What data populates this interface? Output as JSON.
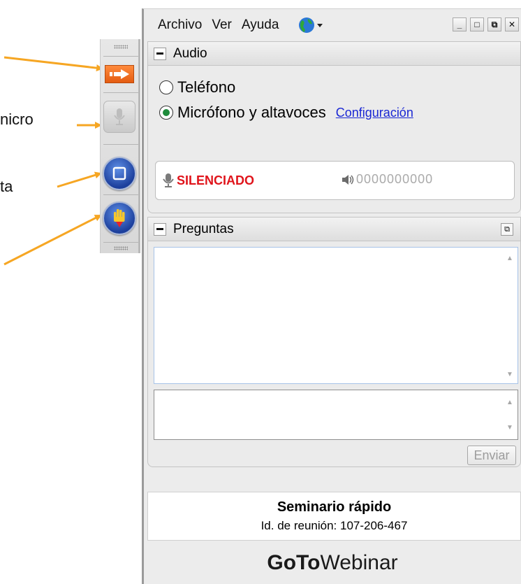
{
  "annotations": {
    "label_1": "nicro",
    "label_2": "ta"
  },
  "colors": {
    "arrow": "#f6a623",
    "accent_orange": "#e45c12",
    "muted_red": "#e0141b",
    "link_blue": "#1a27d4"
  },
  "toolbar": {
    "buttons": [
      {
        "name": "expand-panel-button",
        "icon": "arrow-right-icon"
      },
      {
        "name": "microphone-button",
        "icon": "microphone-icon"
      },
      {
        "name": "screen-button",
        "icon": "square-icon"
      },
      {
        "name": "raise-hand-button",
        "icon": "hand-icon"
      }
    ]
  },
  "menu": {
    "items": [
      "Archivo",
      "Ver",
      "Ayuda"
    ],
    "language_icon": "globe-icon"
  },
  "window_controls": {
    "minimize": "_",
    "maximize": "□",
    "restore": "⧉",
    "close": "✕"
  },
  "audio": {
    "title": "Audio",
    "option_phone": "Teléfono",
    "option_mic": "Micrófono y altavoces",
    "selected": "Micrófono y altavoces",
    "settings_link": "Configuración",
    "status": "SILENCIADO",
    "level_meter": "0000000000"
  },
  "questions": {
    "title": "Preguntas",
    "send_label": "Enviar"
  },
  "session": {
    "title": "Seminario rápido",
    "meeting_id": "Id. de reunión: 107-206-467"
  },
  "brand": {
    "bold": "GoTo",
    "light": "Webinar"
  }
}
